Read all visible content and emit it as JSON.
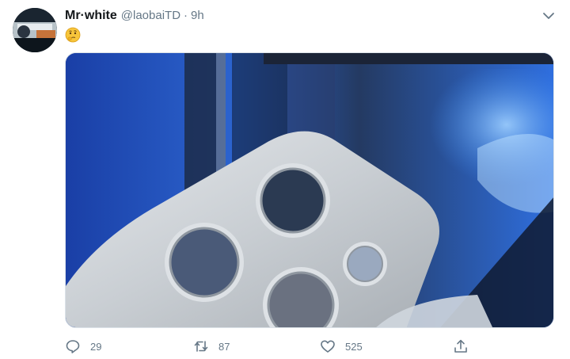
{
  "tweet": {
    "display_name": "Mr·white",
    "handle": "@laobaiTD",
    "separator": "·",
    "time": "9h",
    "emoji": "🤔",
    "media_alt": "",
    "counts": {
      "reply": "29",
      "retweet": "87",
      "like": "525"
    }
  },
  "icons": {
    "caret": "chevron-down-icon",
    "reply": "reply-icon",
    "retweet": "retweet-icon",
    "like": "heart-icon",
    "share": "share-icon"
  },
  "colors": {
    "text_primary": "#14171a",
    "text_secondary": "#657786",
    "border": "#dbe2e8"
  }
}
